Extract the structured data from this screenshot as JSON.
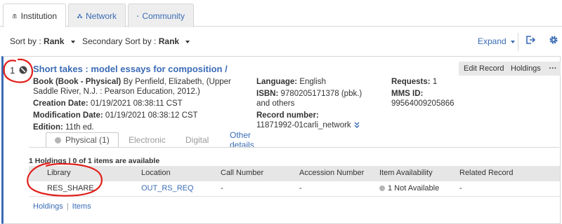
{
  "tabs": [
    {
      "label": "Institution",
      "icon": "institution-icon"
    },
    {
      "label": "Network",
      "icon": "network-icon"
    },
    {
      "label": "Community",
      "icon": "community-icon"
    }
  ],
  "sort": {
    "sort_by_label": "Sort by :",
    "sort_by_value": "Rank",
    "secondary_label": "Secondary Sort by :",
    "secondary_value": "Rank",
    "expand_label": "Expand"
  },
  "record": {
    "number": "1",
    "title": "Short takes : model essays for composition /",
    "buttons": {
      "edit": "Edit Record",
      "holdings": "Holdings",
      "more": "···"
    },
    "col1": {
      "type_label": "Book (Book - Physical)",
      "by_text": "By Penfield, Elizabeth, (Upper Saddle River, N.J. : Pearson Education, 2012.)",
      "creation_label": "Creation Date:",
      "creation_value": "01/19/2021 08:38:11 CST",
      "modification_label": "Modification Date:",
      "modification_value": "01/19/2021 08:38:12 CST",
      "edition_label": "Edition:",
      "edition_value": "11th ed."
    },
    "col2": {
      "language_label": "Language:",
      "language_value": "English",
      "isbn_label": "ISBN:",
      "isbn_value": "9780205171378 (pbk.) and others",
      "recnum_label": "Record number:",
      "recnum_value": "11871992-01carli_network"
    },
    "col3": {
      "requests_label": "Requests:",
      "requests_value": "1",
      "mms_label": "MMS ID:",
      "mms_value": "99564009205866"
    },
    "inner_tabs": {
      "physical": "Physical (1)",
      "electronic": "Electronic",
      "digital": "Digital",
      "other": "Other details"
    },
    "holdings_summary": "1 Holdings | 0 of 1 items are available",
    "table": {
      "headers": [
        "Library",
        "Location",
        "Call Number",
        "Accession Number",
        "Item Availability",
        "Related Record"
      ],
      "rows": [
        {
          "library": "RES_SHARE",
          "location": "OUT_RS_REQ",
          "call_number": "-",
          "accession": "-",
          "availability": "1 Not Available",
          "related": "-"
        }
      ]
    },
    "footer": {
      "holdings": "Holdings",
      "items": "Items"
    }
  },
  "colors": {
    "link": "#3a6bb5",
    "annotation": "#e0201b",
    "accent_border": "#3a6bb5"
  }
}
